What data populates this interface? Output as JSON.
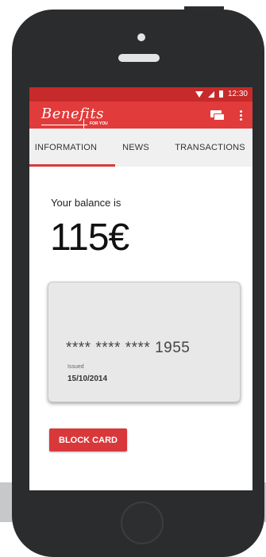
{
  "status_bar": {
    "time": "12:30"
  },
  "app_bar": {
    "logo_text": "Benefits",
    "logo_sub": "FOR YOU"
  },
  "tabs": [
    {
      "label": "INFORMATION",
      "active": true
    },
    {
      "label": "NEWS",
      "active": false
    },
    {
      "label": "TRANSACTIONS",
      "active": false
    }
  ],
  "balance": {
    "label": "Your balance is",
    "amount": "115€"
  },
  "card": {
    "number": "**** **** **** 1955",
    "issued_label": "Issued",
    "issued_date": "15/10/2014"
  },
  "actions": {
    "block_card": "BLOCK CARD"
  },
  "colors": {
    "primary": "#e23b3b",
    "status_bar": "#c62a2a",
    "phone_body": "#2a2c2e"
  },
  "icons": [
    "wifi-icon",
    "signal-icon",
    "battery-icon",
    "chat-icon",
    "more-icon"
  ]
}
